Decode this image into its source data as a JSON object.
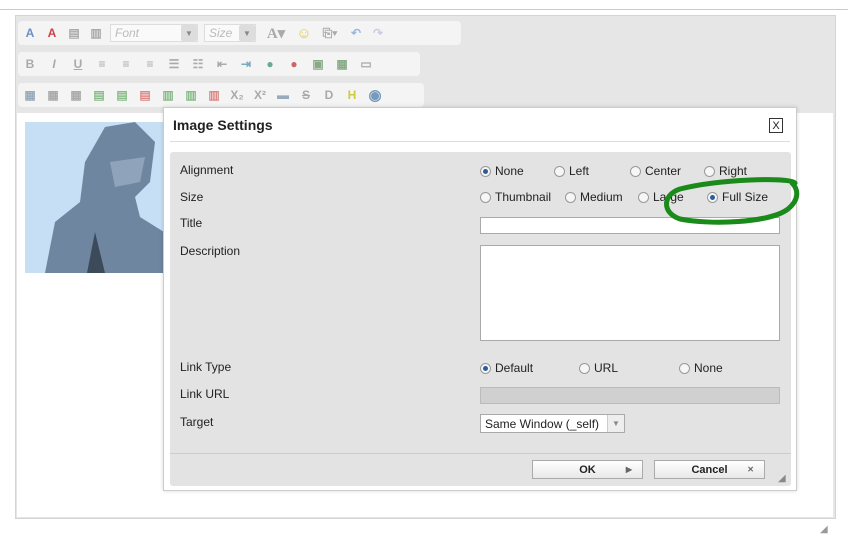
{
  "toolbar": {
    "font_placeholder": "Font",
    "size_placeholder": "Size",
    "icons": [
      "text-color",
      "remove-format",
      "paste-text",
      "paste-word",
      "font-select",
      "size-select",
      "font-size",
      "emoticon",
      "attachment",
      "undo",
      "redo",
      "bold",
      "italic",
      "underline",
      "align-left",
      "align-center",
      "align-right",
      "ordered-list",
      "unordered-list",
      "outdent",
      "indent",
      "insert-link",
      "remove-link",
      "insert-image",
      "insert-media",
      "comment",
      "table",
      "table-properties",
      "delete-table",
      "insert-row-before",
      "insert-row-after",
      "delete-row",
      "insert-column-before",
      "insert-column-after",
      "delete-column",
      "subscript",
      "superscript",
      "horizontal-rule",
      "strikethrough",
      "d",
      "h",
      "media"
    ]
  },
  "dialog": {
    "title": "Image Settings",
    "close_label": "X",
    "alignment": {
      "label": "Alignment",
      "options": [
        "None",
        "Left",
        "Center",
        "Right"
      ],
      "selected": "None"
    },
    "size": {
      "label": "Size",
      "options": [
        "Thumbnail",
        "Medium",
        "Large",
        "Full Size"
      ],
      "selected": "Full Size"
    },
    "title_field": {
      "label": "Title",
      "value": ""
    },
    "description": {
      "label": "Description",
      "value": ""
    },
    "link_type": {
      "label": "Link Type",
      "options": [
        "Default",
        "URL",
        "None"
      ],
      "selected": "Default"
    },
    "link_url": {
      "label": "Link URL",
      "value": ""
    },
    "target": {
      "label": "Target",
      "value": "Same Window (_self)"
    },
    "ok_label": "OK",
    "cancel_label": "Cancel"
  },
  "annotation_color": "#1a8a1a"
}
